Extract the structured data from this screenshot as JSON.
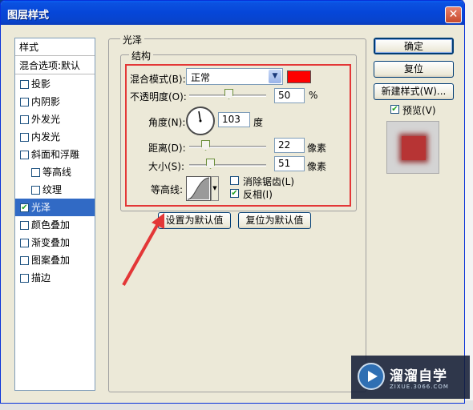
{
  "dialog": {
    "title": "图层样式",
    "close": "✕"
  },
  "style_list": {
    "header": "样式",
    "blend_options": "混合选项:默认",
    "items": [
      {
        "label": "投影",
        "checked": false
      },
      {
        "label": "内阴影",
        "checked": false
      },
      {
        "label": "外发光",
        "checked": false
      },
      {
        "label": "内发光",
        "checked": false
      },
      {
        "label": "斜面和浮雕",
        "checked": false
      },
      {
        "label": "等高线",
        "checked": false
      },
      {
        "label": "纹理",
        "checked": false
      },
      {
        "label": "光泽",
        "checked": true,
        "selected": true
      },
      {
        "label": "颜色叠加",
        "checked": false
      },
      {
        "label": "渐变叠加",
        "checked": false
      },
      {
        "label": "图案叠加",
        "checked": false
      },
      {
        "label": "描边",
        "checked": false
      }
    ],
    "check_mark": "✔"
  },
  "satin": {
    "group_title": "光泽",
    "structure_title": "结构",
    "blend_mode_label": "混合模式(B):",
    "blend_mode_value": "正常",
    "blend_color": "#fe0000",
    "opacity_label": "不透明度(O):",
    "opacity_value": "50",
    "opacity_unit": "%",
    "angle_label": "角度(N):",
    "angle_value": "103",
    "angle_unit": "度",
    "distance_label": "距离(D):",
    "distance_value": "22",
    "distance_unit": "像素",
    "size_label": "大小(S):",
    "size_value": "51",
    "size_unit": "像素",
    "contour_label": "等高线:",
    "antialias_label": "消除锯齿(L)",
    "antialias_checked": false,
    "invert_label": "反相(I)",
    "invert_checked": true
  },
  "default_buttons": {
    "set_default": "设置为默认值",
    "reset_default": "复位为默认值"
  },
  "right_buttons": {
    "ok": "确定",
    "reset": "复位",
    "new_style": "新建样式(W)...",
    "preview_label": "预览(V)",
    "preview_checked": true
  },
  "watermark": {
    "title": "溜溜自学",
    "subtitle": "ZIXUE.3066.COM"
  },
  "colors": {
    "accent_highlight": "#e33737",
    "selection": "#316ac5",
    "preview_swatch": "#b73434"
  }
}
